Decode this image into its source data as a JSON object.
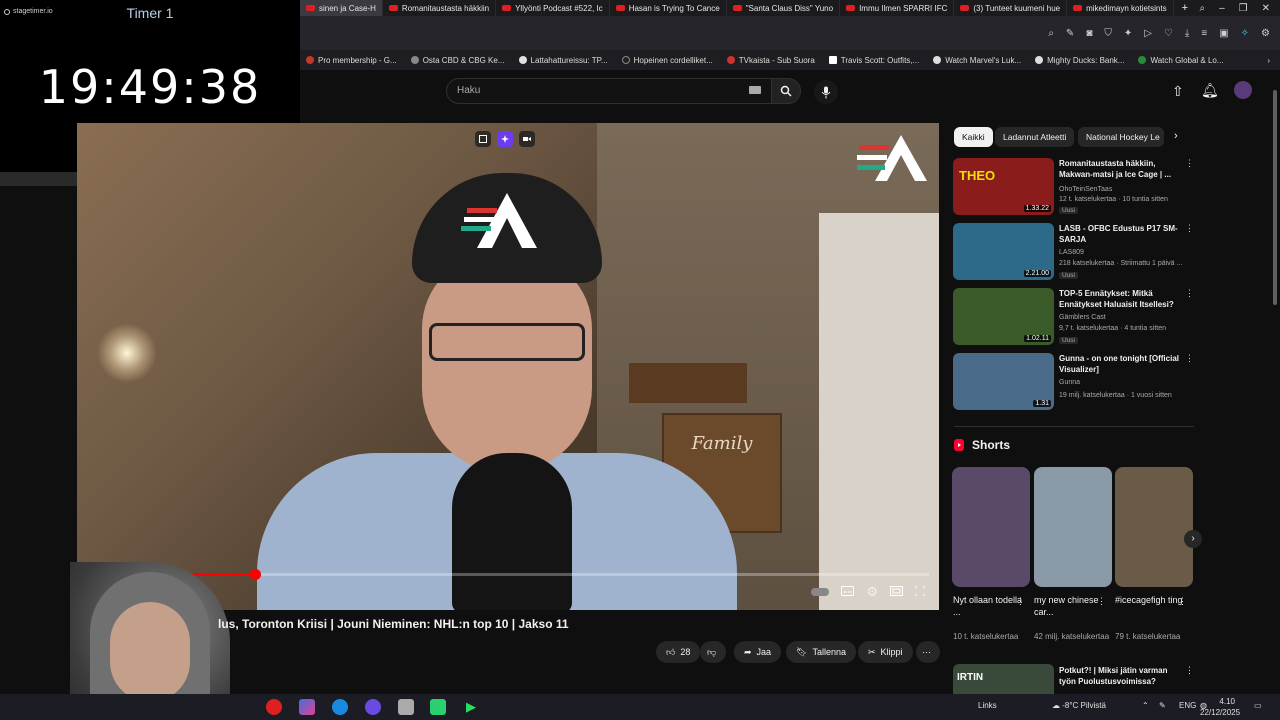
{
  "timer": {
    "brand": "stagetimer.io",
    "name": "Timer 1",
    "time": "19:49:38",
    "progress_fraction": 0.51
  },
  "browser": {
    "tabs": [
      "sinen ja Case-H",
      "Romanitaustasta häkkiin",
      "Yllyönti Podcast #522, Ic",
      "Hasan is Trying To Cance",
      "\"Santa Claus Diss\" Yuno",
      "Immu Ilmen SPARRI IFC",
      "(3) Tunteet kuumeni hue",
      "mikedimayn kotietsints"
    ],
    "bookmarks": [
      "Pro membership - G...",
      "Osta CBD & CBG Ke...",
      "Lattahattureissu: TP...",
      "Hopeinen cordelliket...",
      "TVkaista - Sub Suora",
      "Travis Scott: Outfits,...",
      "Watch Marvel's Luk...",
      "Mighty Ducks: Bank...",
      "Watch Global & Lo..."
    ]
  },
  "youtube": {
    "search_placeholder": "Haku",
    "video": {
      "title": "lus, Toronton Kriisi | Jouni Nieminen: NHL:n top 10 | Jakso 11",
      "sign_text": "Family",
      "played_fraction": 0.2
    },
    "actions": {
      "likes": "28",
      "share": "Jaa",
      "save": "Tallenna",
      "clip": "Klippi"
    },
    "chips": [
      "Kaikki",
      "Ladannut Atleetti",
      "National Hockey Le"
    ],
    "recommendations": [
      {
        "title": "Romanitaustasta häkkiin, Makwan-matsi ja Ice Cage | ...",
        "channel": "OhoTeinSenTaas",
        "meta": "12 t. katselukertaa · 10 tuntia sitten",
        "badge": "Uusi",
        "duration": "1.33.22",
        "thumb_color": "#8a1c1c"
      },
      {
        "title": "LASB - OFBC Edustus P17 SM-SARJA",
        "channel": "LAS809",
        "meta": "218 katselukertaa · Striimattu 1 päivä ...",
        "badge": "Uusi",
        "duration": "2.21.00",
        "thumb_color": "#2d6a8a"
      },
      {
        "title": "TOP-5 Ennätykset: Mitkä Ennätykset Haluaisit Itsellesi?",
        "channel": "Gämblers Cast",
        "meta": "9,7 t. katselukertaa · 4 tuntia sitten",
        "badge": "Uusi",
        "duration": "1.02.11",
        "thumb_color": "#3a5a2a"
      },
      {
        "title": "Gunna - on one tonight [Official Visualizer]",
        "channel": "Gunna",
        "meta": "19 milj. katselukertaa · 1 vuosi sitten",
        "badge": "",
        "duration": "1.31",
        "thumb_color": "#4a6a8a"
      }
    ],
    "shorts_heading": "Shorts",
    "shorts": [
      {
        "title": "Nyt ollaan todella ...",
        "views": "10 t. katselukertaa",
        "color": "#5a4a6a"
      },
      {
        "title": "my new chinese car...",
        "views": "42 milj. katselukertaa",
        "color": "#8a9aa8"
      },
      {
        "title": "#icecagefigh ting",
        "views": "79 t. katselukertaa",
        "color": "#6a5a48"
      }
    ],
    "next_rec_title": "Potkut?! | Miksi jätin varman työn Puolustusvoimissa?",
    "next_rec_thumb_text": "IRTIN"
  },
  "taskbar": {
    "links": "Links",
    "weather": "-8°C  Pilvistä",
    "lang": "ENG",
    "time": "4.10",
    "date": "22/12/2025"
  },
  "colors": {
    "accent_red": "#ff0000",
    "timer_green": "#1ed760",
    "background": "#0f0f0f"
  }
}
